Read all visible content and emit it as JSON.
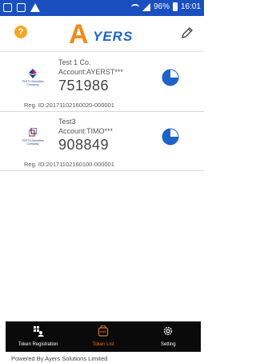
{
  "status_bar": {
    "battery": "96%",
    "time": "16:01"
  },
  "header": {
    "logo_text": "AYERS",
    "help_glyph": "?"
  },
  "tokens": [
    {
      "company": "Test 1 Co.",
      "account": "Account:AYERST***",
      "token": "751986",
      "reg_id": "Reg. ID:20171102160020-000001",
      "logo_caption": "TEST1 Securities Company",
      "progress": 0.75
    },
    {
      "company": "Test3",
      "account": "Account:TIMO***",
      "token": "908849",
      "reg_id": "Reg. ID:20171102160100-000001",
      "logo_caption": "TEST3 Securities Company",
      "progress": 0.75
    }
  ],
  "nav": {
    "registration": "Token Registration",
    "list": "Token List",
    "setting": "Setting"
  },
  "footer": "Powered By Ayers Solutions Limited",
  "colors": {
    "status_bar": "#1a4fbf",
    "accent_blue": "#1e64c8",
    "accent_orange": "#f08a1c",
    "nav_active": "#e8732a"
  }
}
